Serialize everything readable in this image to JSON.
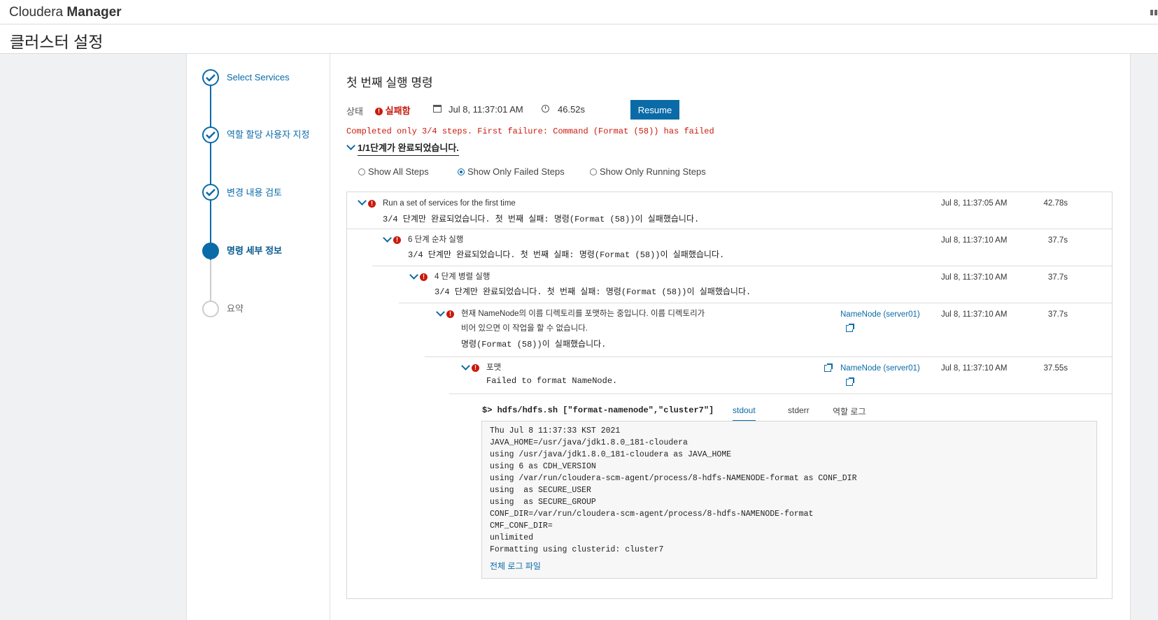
{
  "app": {
    "brand_light": "Cloudera",
    "brand_bold": "Manager"
  },
  "page": {
    "title": "클러스터 설정"
  },
  "wizard": {
    "steps": [
      {
        "label": "Select Services",
        "state": "done"
      },
      {
        "label": "역할 할당 사용자 지정",
        "state": "done"
      },
      {
        "label": "변경 내용 검토",
        "state": "done"
      },
      {
        "label": "명령 세부 정보",
        "state": "current"
      },
      {
        "label": "요약",
        "state": "todo"
      }
    ]
  },
  "command": {
    "title": "첫 번째 실행 명령",
    "status_label": "상태",
    "status_value": "실패함",
    "date": "Jul 8, 11:37:01 AM",
    "duration": "46.52s",
    "resume_label": "Resume",
    "failure_message": "Completed only 3/4 steps. First failure: Command (Format (58)) has failed",
    "progress_summary": "1/1단계가 완료되었습니다.",
    "filters": {
      "all": "Show All Steps",
      "failed": "Show Only Failed Steps",
      "running": "Show Only Running Steps",
      "selected": "failed"
    }
  },
  "steps": [
    {
      "title": "Run a set of services for the first time",
      "detail": "3/4 단계만 완료되었습니다. 첫 번째 실패: 명령(Format (58))이 실패했습니다.",
      "time": "Jul 8, 11:37:05 AM",
      "duration": "42.78s"
    },
    {
      "title": "6 단계 순차 실행",
      "detail": "3/4 단계만 완료되었습니다. 첫 번째 실패: 명령(Format (58))이 실패했습니다.",
      "time": "Jul 8, 11:37:10 AM",
      "duration": "37.7s"
    },
    {
      "title": "4 단계 병렬 실행",
      "detail": "3/4 단계만 완료되었습니다. 첫 번째 실패: 명령(Format (58))이 실패했습니다.",
      "time": "Jul 8, 11:37:10 AM",
      "duration": "37.7s"
    },
    {
      "title_line1": "현재 NameNode의 이름 디렉토리를 포맷하는 중입니다. 이름 디렉토리가",
      "title_line2": "비어 있으면 이 작업을 할 수 없습니다.",
      "detail": "명령(Format (58))이 실패했습니다.",
      "role": "NameNode (server01)",
      "time": "Jul 8, 11:37:10 AM",
      "duration": "37.7s"
    },
    {
      "title": "포맷",
      "detail": "Failed to format NameNode.",
      "role": "NameNode (server01)",
      "time": "Jul 8, 11:37:10 AM",
      "duration": "37.55s"
    }
  ],
  "output": {
    "command": "$> hdfs/hdfs.sh [\"format-namenode\",\"cluster7\"]",
    "tabs": [
      "stdout",
      "stderr",
      "역할 로그"
    ],
    "active_tab": "stdout",
    "lines": [
      "Thu Jul  8 11:37:33 KST 2021",
      "JAVA_HOME=/usr/java/jdk1.8.0_181-cloudera",
      "using /usr/java/jdk1.8.0_181-cloudera as JAVA_HOME",
      "using 6 as CDH_VERSION",
      "using /var/run/cloudera-scm-agent/process/8-hdfs-NAMENODE-format as CONF_DIR",
      "using  as SECURE_USER",
      "using  as SECURE_GROUP",
      "CONF_DIR=/var/run/cloudera-scm-agent/process/8-hdfs-NAMENODE-format",
      "CMF_CONF_DIR=",
      "unlimited",
      "Formatting using clusterid: cluster7"
    ],
    "full_log_link": "전체 로그 파일"
  }
}
